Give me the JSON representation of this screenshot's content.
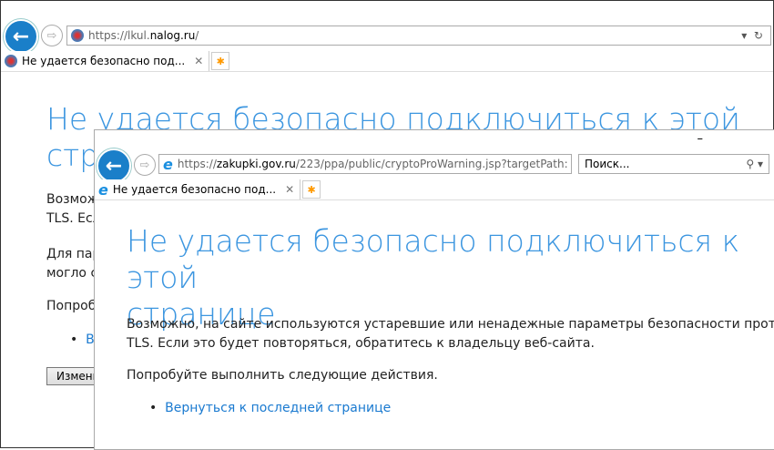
{
  "back_window": {
    "url_prefix": "https://lkul.",
    "url_domain": "nalog.ru",
    "url_suffix": "/",
    "tab_title": "Не удается безопасно под...",
    "heading_line1": "Не удается безопасно подключиться к этой",
    "heading_line2": "стра",
    "para1_line1": "Возмож",
    "para1_line2": "TLS. Есл",
    "para2_line1": "Для пар",
    "para2_line2": "могло с",
    "para3": "Попроб",
    "link": "Ве",
    "button": "Измени"
  },
  "front_window": {
    "url_prefix": "https://",
    "url_domain": "zakupki.gov.ru",
    "url_suffix": "/223/ppa/public/cryptoProWarning.jsp?targetPath:",
    "search_placeholder": "Поиск...",
    "tab_title": "Не удается безопасно под...",
    "minimize": "–",
    "heading_line1": "Не удается безопасно подключиться к этой",
    "heading_line2": "странице",
    "para1_line1": "Возможно, на сайте используются устаревшие или ненадежные параметры безопасности протокола",
    "para1_line2": "TLS. Если это будет повторяться, обратитесь к владельцу веб-сайта.",
    "para2": "Попробуйте выполнить следующие действия.",
    "link": "Вернуться к последней странице"
  }
}
